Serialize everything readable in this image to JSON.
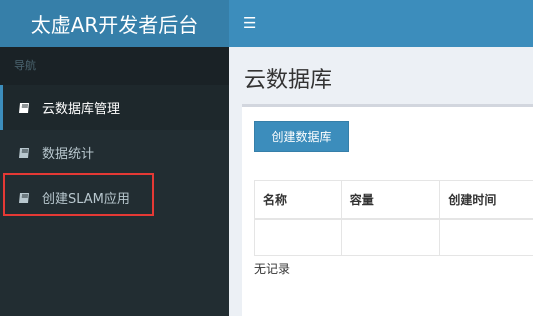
{
  "header": {
    "title": "太虚AR开发者后台",
    "toggle_icon": "menu-icon",
    "colors": {
      "logo_bg": "#367fa9",
      "bar_bg": "#3c8dbc"
    }
  },
  "sidebar": {
    "header": "导航",
    "items": [
      {
        "label": "云数据库管理",
        "icon": "book-icon",
        "active": true
      },
      {
        "label": "数据统计",
        "icon": "book-icon",
        "active": false
      },
      {
        "label": "创建SLAM应用",
        "icon": "book-icon",
        "active": false,
        "highlighted": true
      }
    ]
  },
  "main": {
    "title": "云数据库",
    "create_button": "创建数据库",
    "table": {
      "columns": [
        "名称",
        "容量",
        "创建时间"
      ],
      "rows": []
    },
    "empty_text": "无记录"
  }
}
